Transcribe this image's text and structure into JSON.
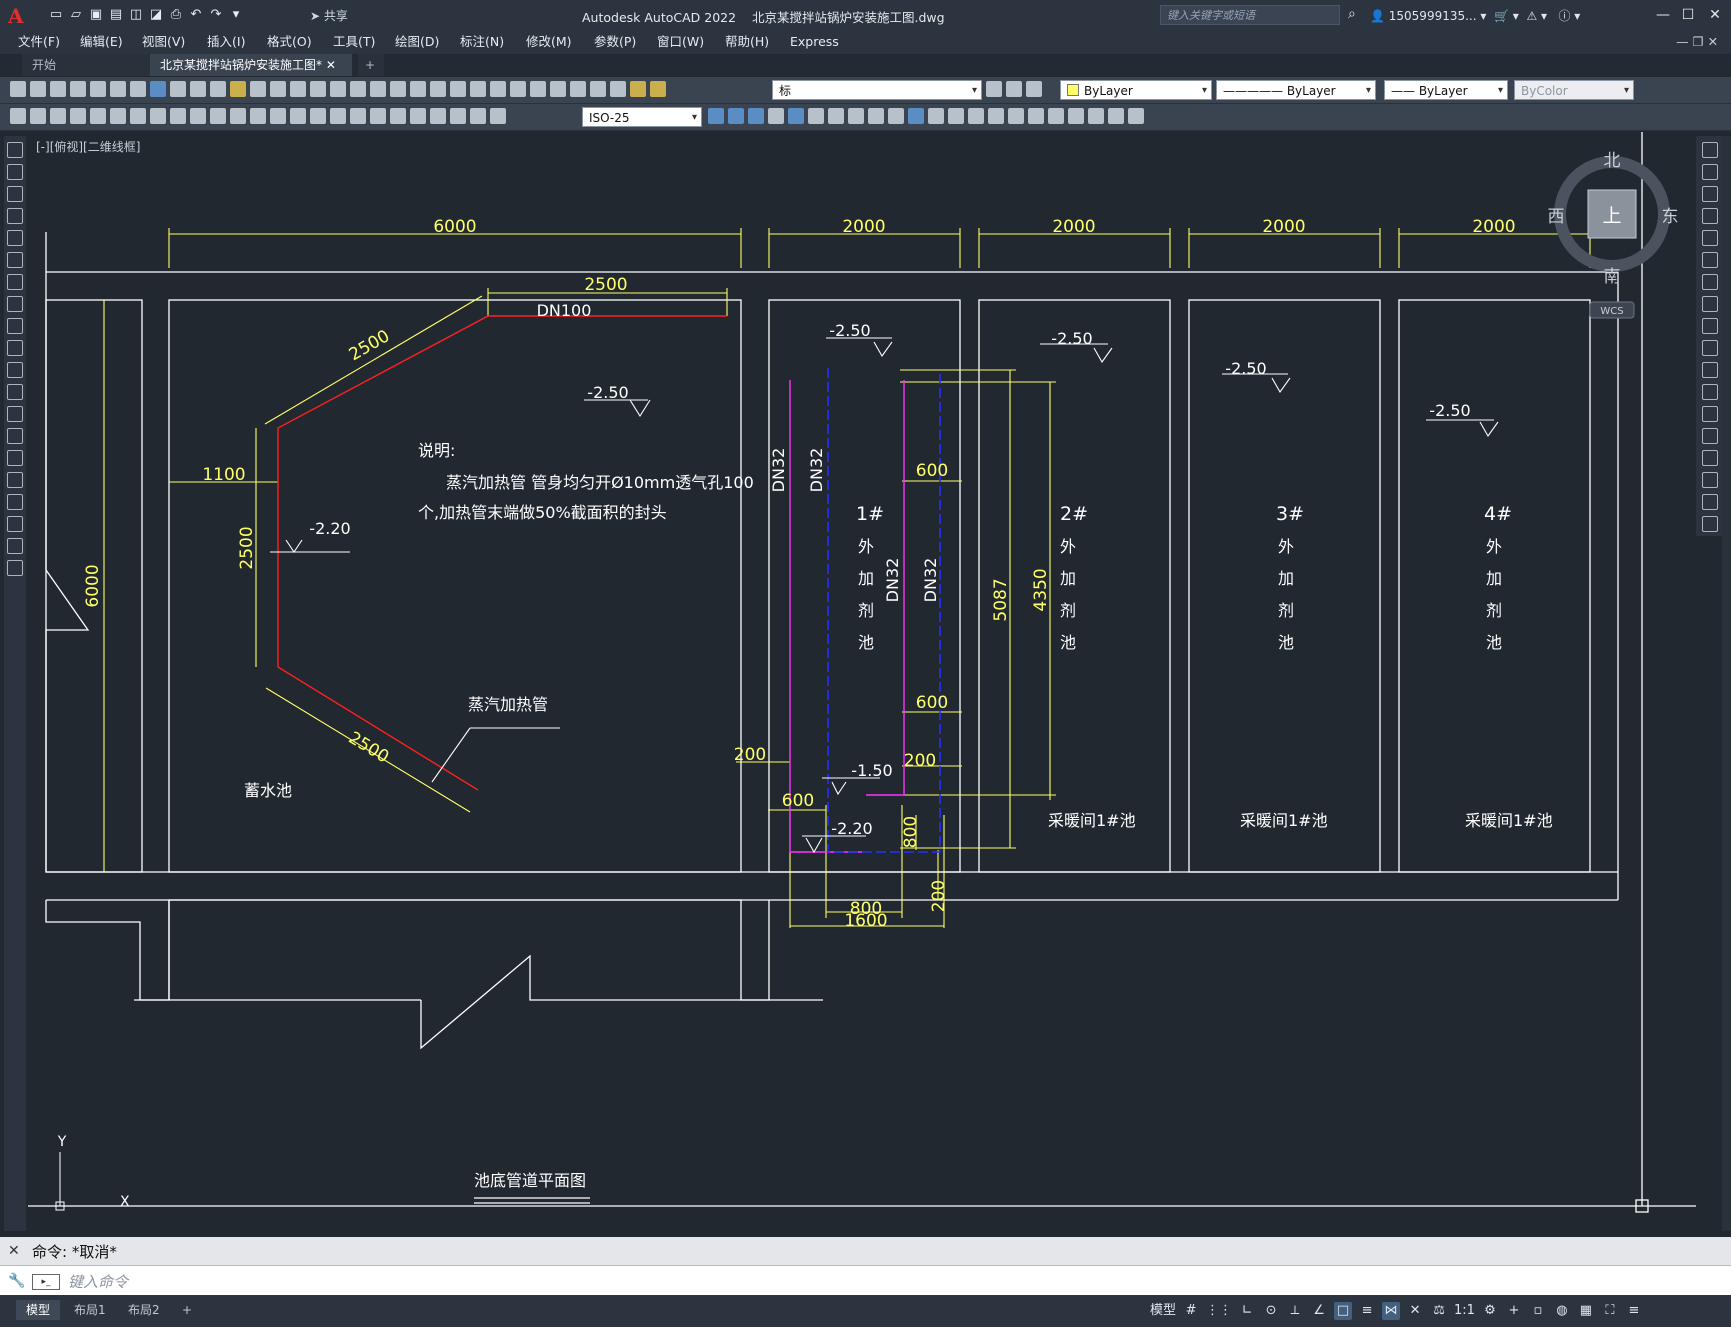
{
  "titlebar": {
    "app_title": "Autodesk AutoCAD 2022",
    "file_title": "北京某搅拌站锅炉安装施工图.dwg",
    "share": "共享",
    "search_placeholder": "键入关键字或短语",
    "user": "1505999135..."
  },
  "menu": [
    "文件(F)",
    "编辑(E)",
    "视图(V)",
    "插入(I)",
    "格式(O)",
    "工具(T)",
    "绘图(D)",
    "标注(N)",
    "修改(M)",
    "参数(P)",
    "窗口(W)",
    "帮助(H)",
    "Express"
  ],
  "tabs": [
    {
      "label": "开始"
    },
    {
      "label": "北京某搅拌站锅炉安装施工图*"
    }
  ],
  "toolbar": {
    "layer_name": "标",
    "color": "ByLayer",
    "linetype": "ByLayer",
    "lineweight": "ByLayer",
    "plotstyle": "ByColor",
    "dimstyle": "ISO-25"
  },
  "viewport": {
    "label": "[-][俯视][二维线框]",
    "viewcube": {
      "north": "北",
      "south": "南",
      "east": "东",
      "west": "西",
      "top": "上",
      "wcs": "WCS"
    }
  },
  "drawing": {
    "dims_top": [
      "6000",
      "2000",
      "2000",
      "2000",
      "2000"
    ],
    "dim_left_6000": "6000",
    "pipe_dims": {
      "d2500_top": "2500",
      "dn100": "DN100",
      "d2500_diag1": "2500",
      "d1100": "1100",
      "d2500_vert": "2500",
      "d2500_diag2": "2500"
    },
    "levels": [
      "-2.50",
      "-2.20",
      "-2.50",
      "-2.50",
      "-2.50",
      "-2.50",
      "-1.50",
      "-2.20"
    ],
    "note_title": "说明:",
    "note_line1": "蒸汽加热管 管身均匀开Ø10mm透气孔100",
    "note_line2": "个,加热管末端做50%截面积的封头",
    "steam_pipe_label": "蒸汽加热管",
    "tank_label": "蓄水池",
    "dn32": [
      "DN32",
      "DN32",
      "DN32",
      "DN32"
    ],
    "pool_titles": [
      "1#",
      "2#",
      "3#",
      "4#"
    ],
    "pool_chars": [
      "外",
      "加",
      "剂",
      "池"
    ],
    "dims_pool1": [
      "600",
      "600",
      "200",
      "200",
      "600",
      "800",
      "800",
      "1600",
      "200",
      "5087",
      "4350"
    ],
    "heating_labels": [
      "采暖间1#池",
      "采暖间1#池",
      "采暖间1#池"
    ],
    "drawing_title": "池底管道平面图",
    "ucs_x": "X",
    "ucs_y": "Y"
  },
  "command": {
    "history": "命令: *取消*",
    "placeholder": "键入命令"
  },
  "layouts": [
    "模型",
    "布局1",
    "布局2"
  ],
  "status": {
    "model": "模型",
    "scale": "1:1"
  }
}
